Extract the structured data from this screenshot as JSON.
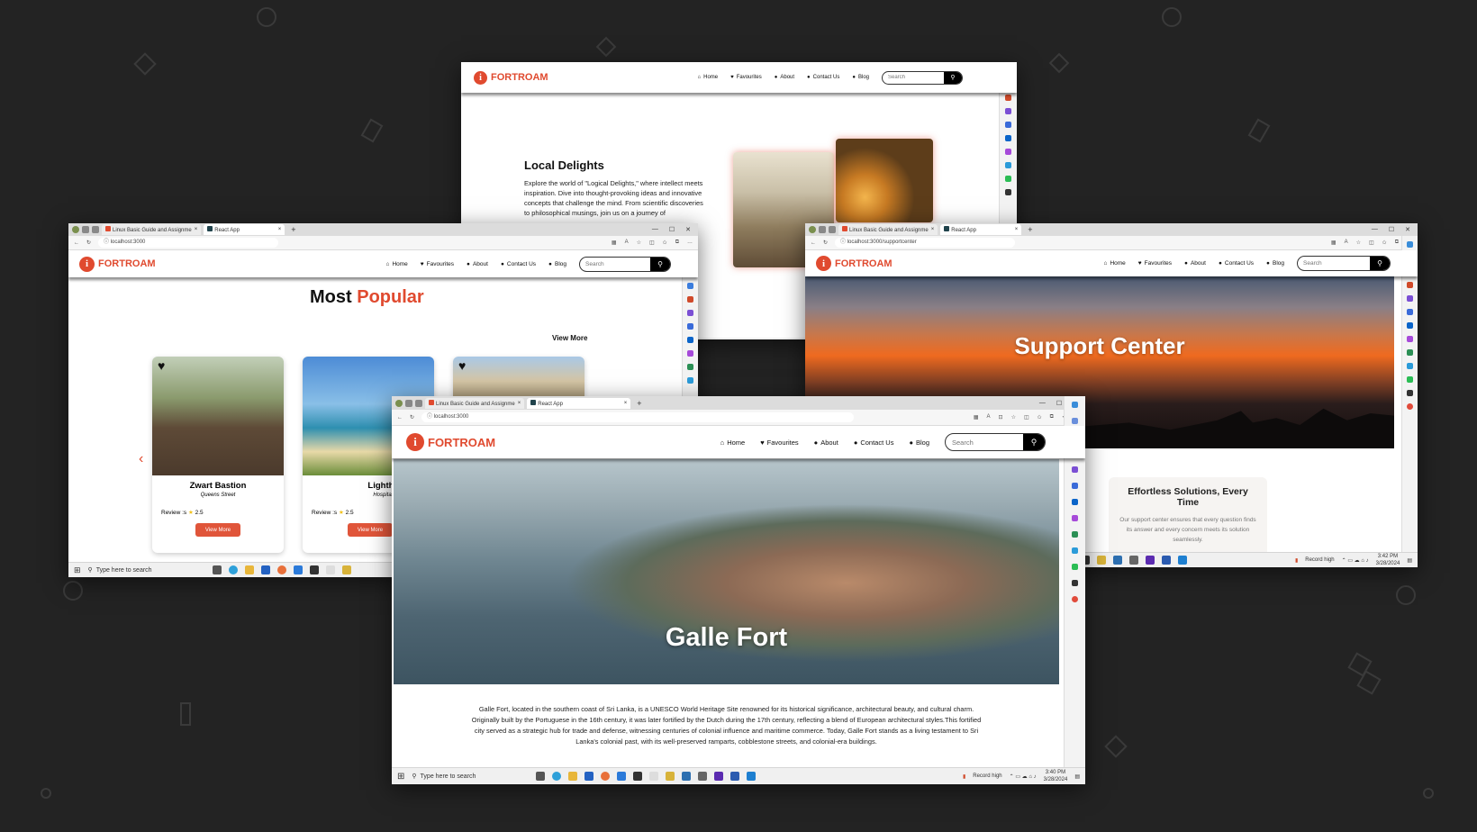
{
  "brand": "FORTROAM",
  "nav": {
    "home": "Home",
    "favourites": "Favourites",
    "about": "About",
    "contact": "Contact Us",
    "blog": "Blog",
    "search_placeholder": "Search"
  },
  "tabs": {
    "tab1": "Linux Basic Guide and Assignme",
    "tab2": "React App",
    "close": "×",
    "new": "+"
  },
  "urls": {
    "home": "localhost:3000",
    "support": "localhost:3000/supportcenter"
  },
  "about_window": {
    "heading": "Local Delights",
    "body": "Explore the world of \"Logical Delights,\" where intellect meets inspiration. Dive into thought-provoking ideas and innovative concepts that challenge the mind. From scientific discoveries to philosophical musings, join us on a journey of"
  },
  "popular_window": {
    "title_a": "Most",
    "title_b": "Popular",
    "view_more": "View More",
    "cards": [
      {
        "name": "Zwart Bastion",
        "street": "Queens Street",
        "review_label": "Review :s",
        "rating": "2.5",
        "button": "View More"
      },
      {
        "name": "Lighthouse",
        "street": "Hospital Street",
        "review_label": "Review :s",
        "rating": "2.5",
        "button": "View More"
      }
    ],
    "prev_arrow": "‹"
  },
  "support_window": {
    "hero": "Support Center",
    "card_title": "Effortless Solutions, Every Time",
    "card_body": "Our support center ensures that every question finds its answer and every concern meets its solution seamlessly."
  },
  "galle_window": {
    "hero": "Galle Fort",
    "body": "Galle Fort, located in the southern coast of Sri Lanka, is a UNESCO World Heritage Site renowned for its historical significance, architectural beauty, and cultural charm. Originally built by the Portuguese in the 16th century, it was later fortified by the Dutch during the 17th century, reflecting a blend of European architectural styles.This fortified city served as a strategic hub for trade and defense, witnessing centuries of colonial influence and maritime commerce. Today, Galle Fort stands as a living testament to Sri Lanka's colonial past, with its well-preserved ramparts, cobblestone streets, and colonial-era buildings."
  },
  "taskbar": {
    "search": "Type here to search",
    "record": "Record high",
    "time_front": "3:40 PM",
    "date_front": "3/28/2024",
    "time_back": "3:42 PM",
    "date_back": "3/28/2024"
  },
  "icons": [
    "home-icon",
    "heart-icon",
    "info-icon",
    "user-icon",
    "search-icon",
    "star-icon"
  ],
  "colors": {
    "accent": "#e04a2f",
    "background": "#232323"
  }
}
